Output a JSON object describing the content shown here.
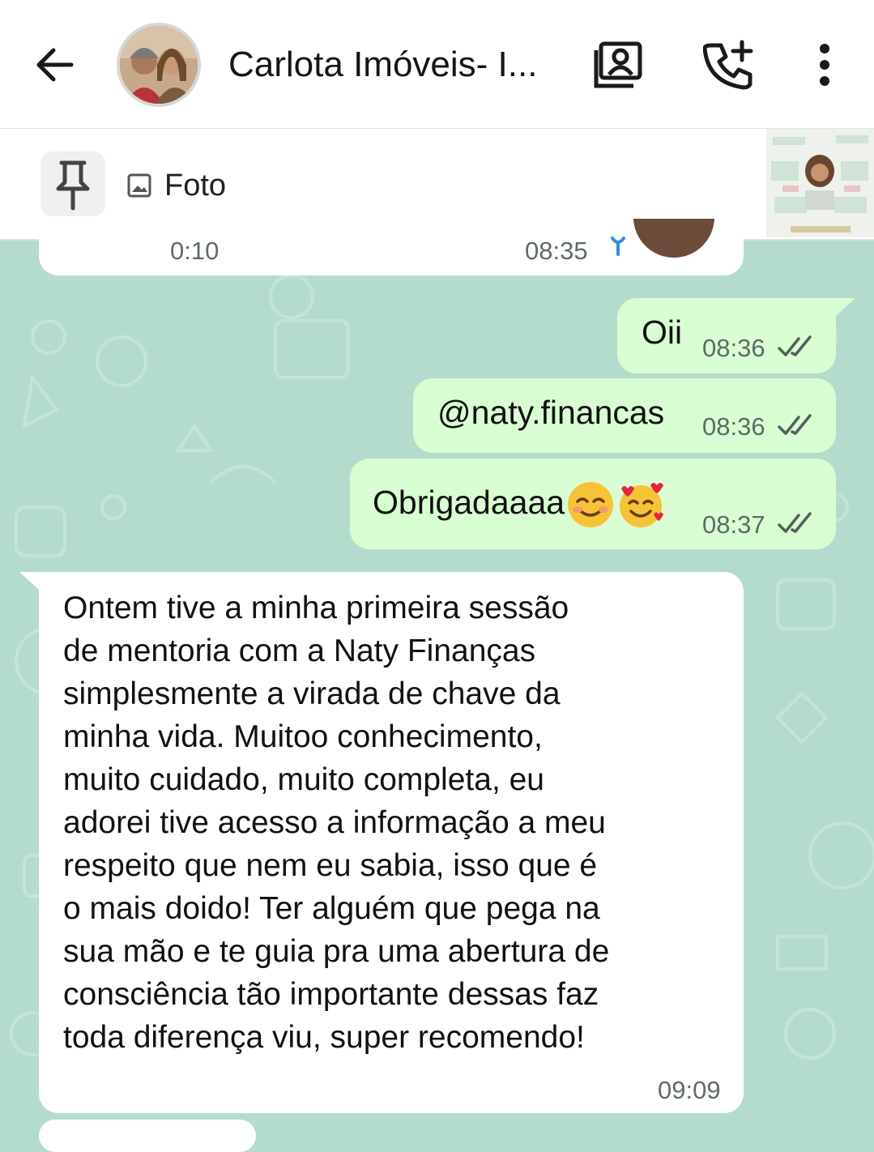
{
  "header": {
    "back_icon": "arrow-back-icon",
    "contact_name": "Carlota Imóveis- I...",
    "avatar": "contact-avatar",
    "actions": [
      "contact-card-icon",
      "add-call-icon",
      "more-vertical-icon"
    ]
  },
  "pinned": {
    "icon": "pin-icon",
    "type_icon": "image-icon",
    "label": "Foto"
  },
  "messages": [
    {
      "direction": "incoming",
      "partial": true,
      "media_duration": "0:10",
      "time": "08:35",
      "sent_icon": "mic-icon"
    },
    {
      "direction": "outgoing",
      "text": "Oii",
      "time": "08:36",
      "status": "read"
    },
    {
      "direction": "outgoing",
      "text": "@naty.financas",
      "time": "08:36",
      "status": "read"
    },
    {
      "direction": "outgoing",
      "text": "Obrigadaaaa",
      "emojis": [
        "smiling-face-emoji",
        "smiling-face-with-hearts-emoji"
      ],
      "time": "08:37",
      "status": "read"
    },
    {
      "direction": "incoming",
      "lines": [
        "Ontem tive a minha primeira sessão",
        "de mentoria com a Naty Finanças",
        "simplesmente a virada de chave da",
        "minha vida. Muitoo conhecimento,",
        "muito cuidado, muito completa, eu",
        "adorei tive acesso a informação a meu",
        "respeito que nem eu sabia, isso que é",
        "o mais doido! Ter alguém que pega na",
        "sua mão e te guia pra uma abertura de",
        "consciência tão importante dessas faz",
        "toda diferença viu, super recomendo!"
      ],
      "time": "09:09"
    }
  ],
  "colors": {
    "wallpaper": "#b4dccd",
    "outgoing_bubble": "#d9fdd3",
    "incoming_bubble": "#ffffff",
    "read_ticks": "#555f5a",
    "mic_blue": "#2b8fe0"
  }
}
